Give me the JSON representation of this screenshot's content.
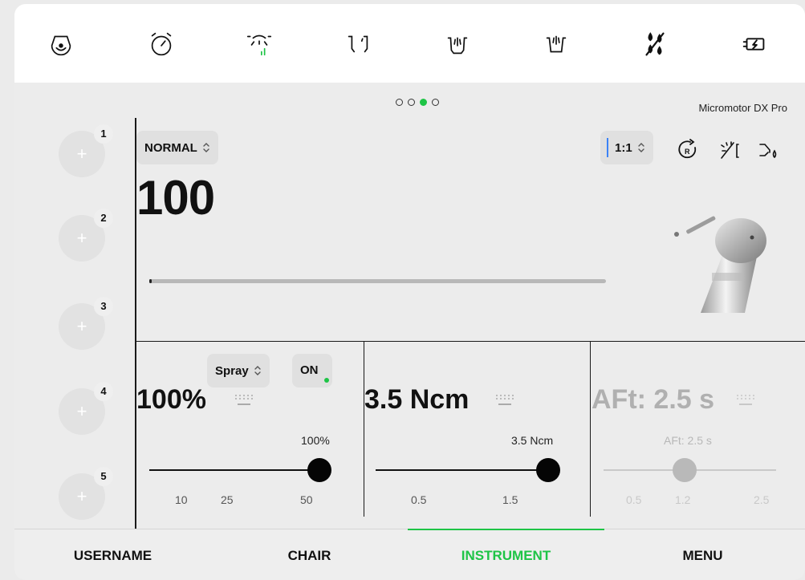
{
  "topbar": {
    "icons": [
      "patient-icon",
      "timer-icon",
      "light-icon",
      "cuspidor-icon",
      "rinse-icon",
      "cup-fill-icon",
      "water-drops-icon",
      "battery-icon"
    ]
  },
  "page_indicator": {
    "count": 4,
    "active_index": 2
  },
  "instrument": {
    "name": "Micromotor DX Pro",
    "mode": "NORMAL",
    "speed": "100",
    "speed_fraction": 0.005,
    "ratio": "1:1"
  },
  "slots": [
    {
      "number": "1",
      "symbol": "+"
    },
    {
      "number": "2",
      "symbol": "+"
    },
    {
      "number": "3",
      "symbol": "+"
    },
    {
      "number": "4",
      "symbol": "+"
    },
    {
      "number": "5",
      "symbol": "+"
    }
  ],
  "panels": {
    "spray": {
      "value": "100%",
      "mode": "Spray",
      "state": "ON",
      "slider_label": "100%",
      "slider_fraction": 1.0,
      "ticks": [
        "10",
        "25",
        "50"
      ]
    },
    "torque": {
      "value": "3.5 Ncm",
      "slider_label": "3.5 Ncm",
      "slider_fraction": 1.0,
      "ticks": [
        "0.5",
        "1.5"
      ]
    },
    "aft": {
      "value": "AFt: 2.5 s",
      "slider_label": "AFt: 2.5 s",
      "slider_fraction": 0.47,
      "ticks": [
        "0.5",
        "1.2",
        "2.5"
      ],
      "disabled": true
    }
  },
  "nav": {
    "items": [
      "USERNAME",
      "CHAIR",
      "INSTRUMENT",
      "MENU"
    ],
    "active": "INSTRUMENT"
  },
  "colors": {
    "accent": "#1ec446",
    "ratio_marker": "#3b82f6"
  }
}
